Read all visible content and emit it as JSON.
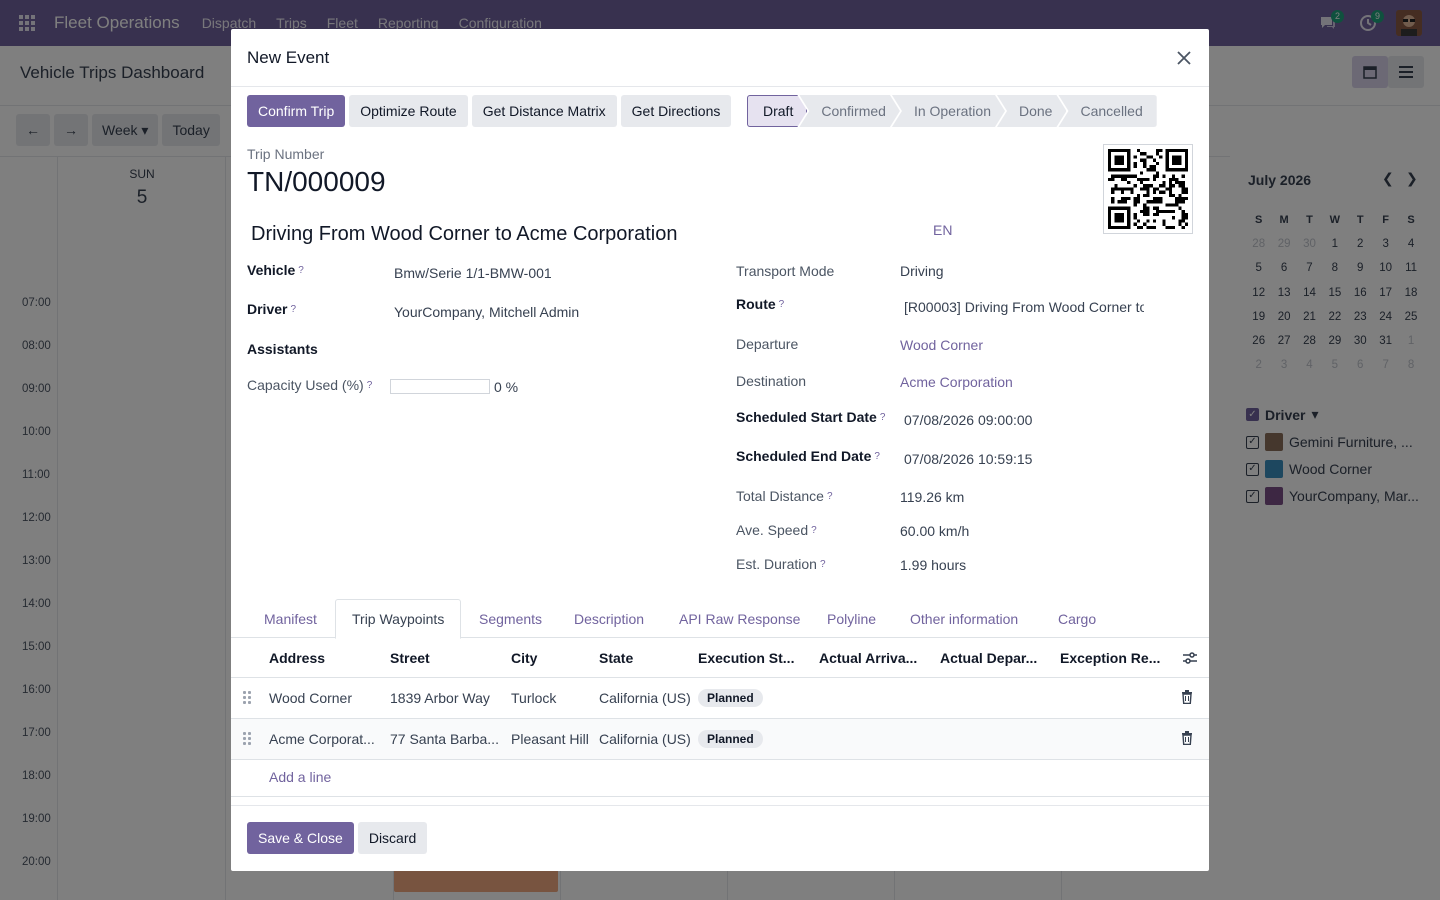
{
  "navbar": {
    "brand": "Fleet Operations",
    "menus": [
      "Dispatch",
      "Trips",
      "Fleet",
      "Reporting",
      "Configuration"
    ],
    "messages_count": "2",
    "activities_count": "9"
  },
  "page": {
    "title": "Vehicle Trips Dashboard"
  },
  "calendar": {
    "buttons": {
      "prev": "←",
      "next": "→",
      "scale": "Week",
      "today": "Today"
    },
    "day_name": "SUN",
    "day_number": "5",
    "times": [
      "07:00",
      "08:00",
      "09:00",
      "10:00",
      "11:00",
      "12:00",
      "13:00",
      "14:00",
      "15:00",
      "16:00",
      "17:00",
      "18:00",
      "19:00",
      "20:00"
    ],
    "mini": {
      "title": "July 2026",
      "weekdays": [
        "S",
        "M",
        "T",
        "W",
        "T",
        "F",
        "S"
      ],
      "weeks": [
        [
          "28",
          "29",
          "30",
          "1",
          "2",
          "3",
          "4"
        ],
        [
          "5",
          "6",
          "7",
          "8",
          "9",
          "10",
          "11"
        ],
        [
          "12",
          "13",
          "14",
          "15",
          "16",
          "17",
          "18"
        ],
        [
          "19",
          "20",
          "21",
          "22",
          "23",
          "24",
          "25"
        ],
        [
          "26",
          "27",
          "28",
          "29",
          "30",
          "31",
          "1"
        ],
        [
          "2",
          "3",
          "4",
          "5",
          "6",
          "7",
          "8"
        ]
      ]
    },
    "filter_title": "Driver",
    "filters": [
      "Gemini Furniture, ...",
      "Wood Corner",
      "YourCompany, Mar..."
    ]
  },
  "modal": {
    "title": "New Event",
    "actions": [
      "Confirm Trip",
      "Optimize Route",
      "Get Distance Matrix",
      "Get Directions"
    ],
    "stages": [
      "Draft",
      "Confirmed",
      "In Operation",
      "Done",
      "Cancelled"
    ],
    "active_stage": "Draft",
    "trip_number_label": "Trip Number",
    "trip_number": "TN/000009",
    "trip_name": "Driving From Wood Corner to Acme Corporation",
    "lang": "EN",
    "left_fields": {
      "vehicle_label": "Vehicle",
      "vehicle": "Bmw/Serie 1/1-BMW-001",
      "driver_label": "Driver",
      "driver": "YourCompany, Mitchell Admin",
      "assistants_label": "Assistants",
      "capacity_label": "Capacity Used (%)",
      "capacity": "0 %",
      "capacity_fraction": 0
    },
    "right_fields": {
      "transport_mode_label": "Transport Mode",
      "transport_mode": "Driving",
      "route_label": "Route",
      "route": "[R00003] Driving From Wood Corner to",
      "departure_label": "Departure",
      "departure": "Wood Corner",
      "destination_label": "Destination",
      "destination": "Acme Corporation",
      "start_label": "Scheduled Start Date",
      "start": "07/08/2026 09:00:00",
      "end_label": "Scheduled End Date",
      "end": "07/08/2026 10:59:15",
      "distance_label": "Total Distance",
      "distance": "119.26 km",
      "speed_label": "Ave. Speed",
      "speed": "60.00 km/h",
      "duration_label": "Est. Duration",
      "duration": "1.99 hours"
    },
    "tabs": [
      "Manifest",
      "Trip Waypoints",
      "Segments",
      "Description",
      "API Raw Response",
      "Polyline",
      "Other information",
      "Cargo"
    ],
    "active_tab": "Trip Waypoints",
    "table": {
      "columns": [
        "Address",
        "Street",
        "City",
        "State",
        "Execution St...",
        "Actual Arriva...",
        "Actual Depar...",
        "Exception Re..."
      ],
      "rows": [
        {
          "address": "Wood Corner",
          "street": "1839 Arbor Way",
          "city": "Turlock",
          "state": "California (US)",
          "status": "Planned"
        },
        {
          "address": "Acme Corporat...",
          "street": "77 Santa Barba...",
          "city": "Pleasant Hill",
          "state": "California (US)",
          "status": "Planned"
        }
      ],
      "add_line": "Add a line"
    },
    "footer": {
      "save": "Save & Close",
      "discard": "Discard"
    }
  }
}
